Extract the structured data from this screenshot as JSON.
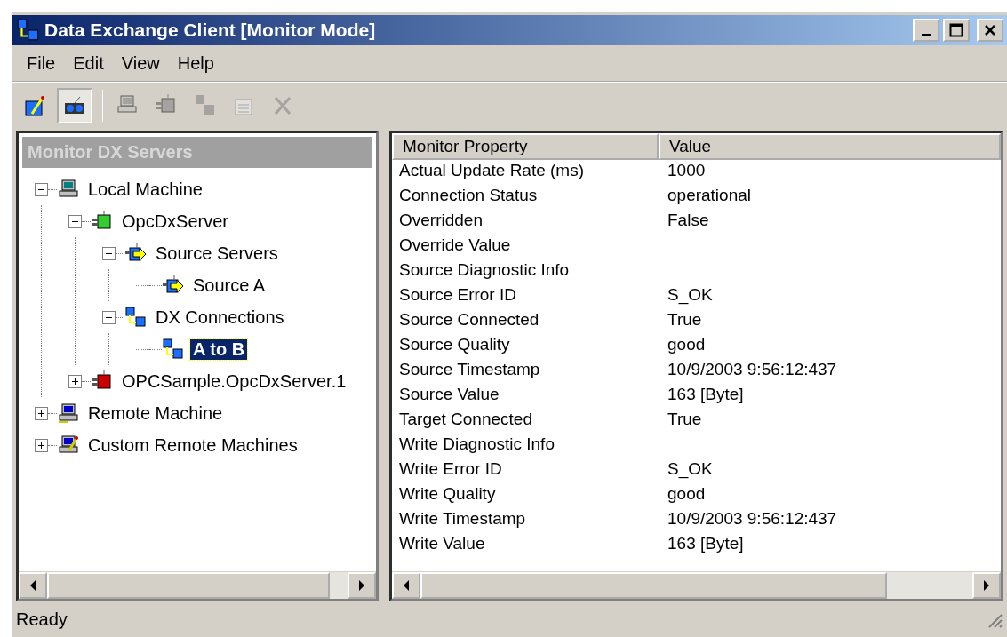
{
  "window": {
    "title": "Data Exchange Client [Monitor Mode]"
  },
  "menu": [
    "File",
    "Edit",
    "View",
    "Help"
  ],
  "toolbar": [
    {
      "kind": "edit",
      "selected": false,
      "disabled": false
    },
    {
      "kind": "monitor",
      "selected": true,
      "disabled": false
    },
    {
      "kind": "computer",
      "selected": false,
      "disabled": true
    },
    {
      "kind": "server",
      "selected": false,
      "disabled": true
    },
    {
      "kind": "connection",
      "selected": false,
      "disabled": true
    },
    {
      "kind": "properties",
      "selected": false,
      "disabled": true
    },
    {
      "kind": "delete",
      "selected": false,
      "disabled": true
    }
  ],
  "tree": {
    "title": "Monitor DX Servers",
    "items": [
      {
        "label": "Local Machine",
        "kind": "computer",
        "expanded": true,
        "selected": false,
        "children": [
          {
            "label": "OpcDxServer",
            "kind": "server-ok",
            "expanded": true,
            "selected": false,
            "children": [
              {
                "label": "Source Servers",
                "kind": "source",
                "expanded": true,
                "selected": false,
                "children": [
                  {
                    "label": "Source A",
                    "kind": "source",
                    "selected": false
                  }
                ]
              },
              {
                "label": "DX Connections",
                "kind": "connection",
                "expanded": true,
                "selected": false,
                "children": [
                  {
                    "label": "A to B",
                    "kind": "connection",
                    "selected": true
                  }
                ]
              }
            ]
          },
          {
            "label": "OPCSample.OpcDxServer.1",
            "kind": "server-error",
            "expanded": false,
            "selected": false
          }
        ]
      },
      {
        "label": "Remote Machine",
        "kind": "network",
        "expanded": false,
        "selected": false
      },
      {
        "label": "Custom Remote Machines",
        "kind": "custom",
        "expanded": false,
        "selected": false
      }
    ]
  },
  "table": {
    "columns": [
      "Monitor Property",
      "Value"
    ],
    "rows": [
      [
        "Actual Update Rate (ms)",
        "1000"
      ],
      [
        "Connection Status",
        "operational"
      ],
      [
        "Overridden",
        "False"
      ],
      [
        "Override Value",
        ""
      ],
      [
        "Source Diagnostic Info",
        ""
      ],
      [
        "Source Error ID",
        "S_OK"
      ],
      [
        "Source Connected",
        "True"
      ],
      [
        "Source Quality",
        "good"
      ],
      [
        "Source Timestamp",
        "10/9/2003 9:56:12:437"
      ],
      [
        "Source Value",
        "163 [Byte]"
      ],
      [
        "Target Connected",
        "True"
      ],
      [
        "Write Diagnostic Info",
        ""
      ],
      [
        "Write Error ID",
        "S_OK"
      ],
      [
        "Write Quality",
        "good"
      ],
      [
        "Write Timestamp",
        "10/9/2003 9:56:12:437"
      ],
      [
        "Write Value",
        "163 [Byte]"
      ]
    ]
  },
  "status_bar": "Ready"
}
